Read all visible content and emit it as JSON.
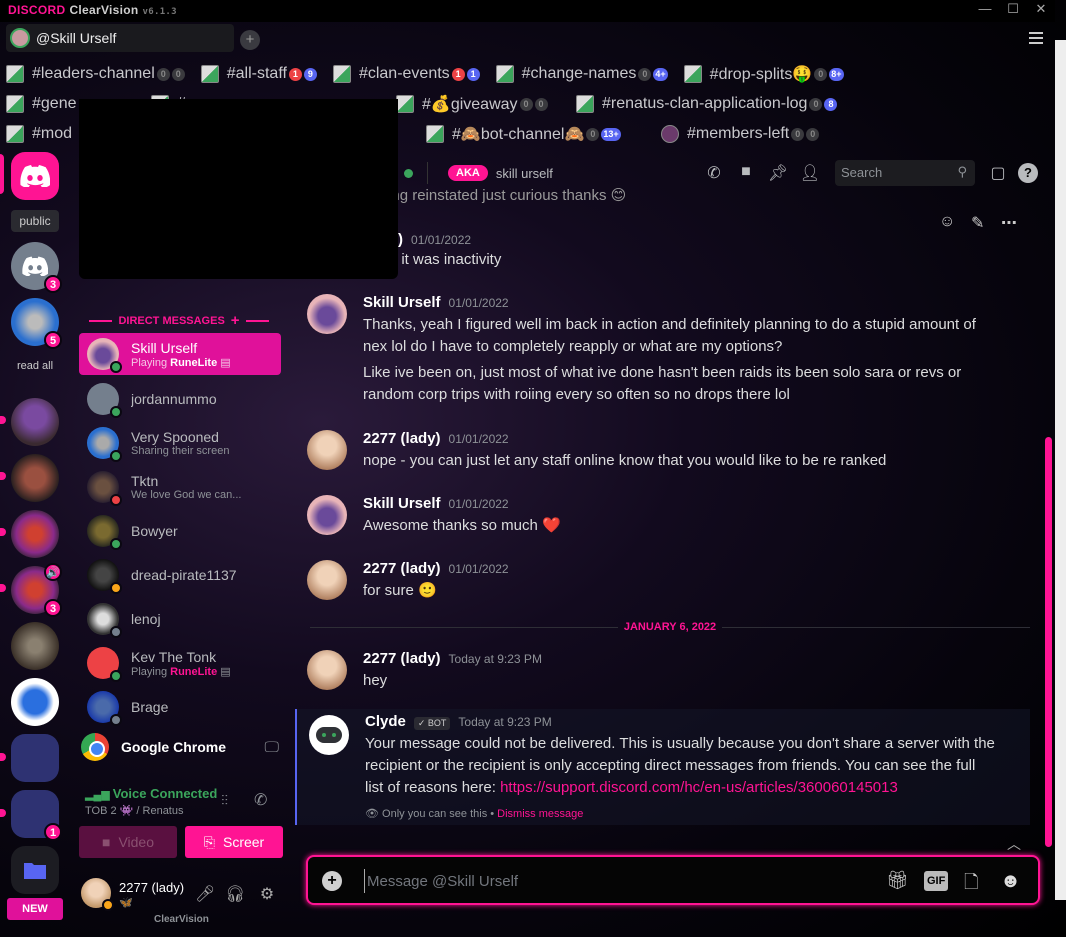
{
  "window": {
    "brand_discord": "DISCORD",
    "brand_theme": "ClearVision",
    "brand_version": "v6.1.3",
    "controls": {
      "minimize": "—",
      "maximize": "☐",
      "close": "✕"
    },
    "menu_icon": "hamburger-icon"
  },
  "tabs": [
    {
      "label": "@Skill Urself",
      "active": true
    }
  ],
  "tab_add": "+",
  "channel_rows": [
    [
      {
        "name": "#leaders-channel",
        "badges": [
          {
            "v": "0",
            "c": "g"
          },
          {
            "v": "0",
            "c": "g"
          }
        ]
      },
      {
        "name": "#all-staff",
        "badges": [
          {
            "v": "1",
            "c": "r"
          },
          {
            "v": "9",
            "c": "b"
          }
        ]
      },
      {
        "name": "#clan-events",
        "badges": [
          {
            "v": "1",
            "c": "r"
          },
          {
            "v": "1",
            "c": "b"
          }
        ]
      },
      {
        "name": "#change-names",
        "badges": [
          {
            "v": "0",
            "c": "g"
          },
          {
            "v": "4+",
            "c": "b"
          }
        ]
      },
      {
        "name": "#drop-splits🤑",
        "badges": [
          {
            "v": "0",
            "c": "g"
          },
          {
            "v": "8+",
            "c": "b"
          }
        ]
      }
    ],
    [
      {
        "name": "#gene",
        "badges": []
      },
      {
        "name": "#",
        "badges": []
      },
      {
        "name": "#💰giveaway",
        "badges": [
          {
            "v": "0",
            "c": "g"
          },
          {
            "v": "0",
            "c": "g"
          }
        ]
      },
      {
        "name": "#renatus-clan-application-log",
        "badges": [
          {
            "v": "0",
            "c": "g"
          },
          {
            "v": "8",
            "c": "b"
          }
        ]
      }
    ],
    [
      {
        "name": "#mod",
        "badges": []
      },
      {
        "name": "#🙈bot-channel🙈",
        "badges": [
          {
            "v": "0",
            "c": "g"
          },
          {
            "v": "13+",
            "c": "b"
          }
        ]
      },
      {
        "name": "#members-left",
        "badges": [
          {
            "v": "0",
            "c": "g"
          },
          {
            "v": "0",
            "c": "g"
          }
        ],
        "avatar": true
      }
    ]
  ],
  "guilds": {
    "home_label": "public",
    "read_all": "read all",
    "badges": {
      "server1": "3",
      "server2": "5",
      "renatus2": "3",
      "folder2": "1"
    },
    "new_label": "NEW"
  },
  "dm": {
    "header": "DIRECT MESSAGES",
    "add": "+",
    "items": [
      {
        "name": "Skill Urself",
        "sub_prefix": "Playing ",
        "sub_game": "RuneLite",
        "status": "online",
        "selected": true
      },
      {
        "name": "jordannummo",
        "sub_prefix": "",
        "sub_game": "",
        "status": "online"
      },
      {
        "name": "Very Spooned",
        "sub_prefix": "Sharing their screen",
        "sub_game": "",
        "status": "online"
      },
      {
        "name": "Tktn",
        "sub_prefix": "We love God we can...",
        "sub_game": "",
        "status": "dnd"
      },
      {
        "name": "Bowyer",
        "sub_prefix": "",
        "sub_game": "",
        "status": "online"
      },
      {
        "name": "dread-pirate1137",
        "sub_prefix": "",
        "sub_game": "",
        "status": "idle"
      },
      {
        "name": "lenoj",
        "sub_prefix": "",
        "sub_game": "",
        "status": "offline"
      },
      {
        "name": "Kev The Tonk",
        "sub_prefix": "Playing ",
        "sub_game": "RuneLite",
        "status": "online"
      },
      {
        "name": "Brage",
        "sub_prefix": "",
        "sub_game": "",
        "status": "offline"
      }
    ]
  },
  "activity": {
    "app": "Google Chrome"
  },
  "voice": {
    "title": "Voice Connected",
    "channel": "TOB 2 👾 / Renatus",
    "video_label": "Video",
    "screen_label": "Screer"
  },
  "user": {
    "name": "2277 (lady)",
    "status_emoji": "🦋",
    "footer": "ClearVision"
  },
  "chat": {
    "header_name": "",
    "aka_label": "AKA",
    "aka_value": "skill urself",
    "search_placeholder": "Search",
    "messages": [
      {
        "fragment": "getting reinstated just curious thanks 😊"
      },
      {
        "author": "(lady)",
        "ts": "01/01/2022",
        "lines": [
          "skill - it was inactivity"
        ]
      },
      {
        "author": "Skill Urself",
        "ts": "01/01/2022",
        "lines": [
          "Thanks, yeah I figured well im back in action and definitely planning to do a stupid amount of nex lol do I have to completely reapply or what are my options?",
          "Like ive been on, just most of what ive done hasn't been raids its been solo sara or revs or random corp trips with roiing every so often so no drops there lol"
        ]
      },
      {
        "author": "2277 (lady)",
        "ts": "01/01/2022",
        "lines": [
          "nope - you can just let any staff online know that you would like to be re ranked"
        ]
      },
      {
        "author": "Skill Urself",
        "ts": "01/01/2022",
        "lines": [
          "Awesome thanks so much ❤️"
        ]
      },
      {
        "author": "2277 (lady)",
        "ts": "01/01/2022",
        "lines": [
          "for sure 🙂"
        ]
      },
      {
        "author": "2277 (lady)",
        "ts": "Today at 9:23 PM",
        "lines": [
          "hey"
        ]
      },
      {
        "author": "Clyde",
        "bot_tag": "✓ BOT",
        "ts": "Today at 9:23 PM",
        "lines": [
          "Your message could not be delivered. This is usually because you don't share a server with the recipient or the recipient is only accepting direct messages from friends. You can see the full list of reasons here: "
        ],
        "link": "https://support.discord.com/hc/en-us/articles/360060145013",
        "ephemeral_note": "Only you can see this •",
        "dismiss": "Dismiss message"
      }
    ],
    "date_divider": "JANUARY 6, 2022",
    "composer_placeholder": "Message @Skill Urself",
    "gif_label": "GIF"
  },
  "colors": {
    "accent": "#ff1493",
    "online": "#3ba55c",
    "dnd": "#ed4245",
    "idle": "#faa61a",
    "offline": "#747f8d",
    "blurple": "#5865f2"
  }
}
